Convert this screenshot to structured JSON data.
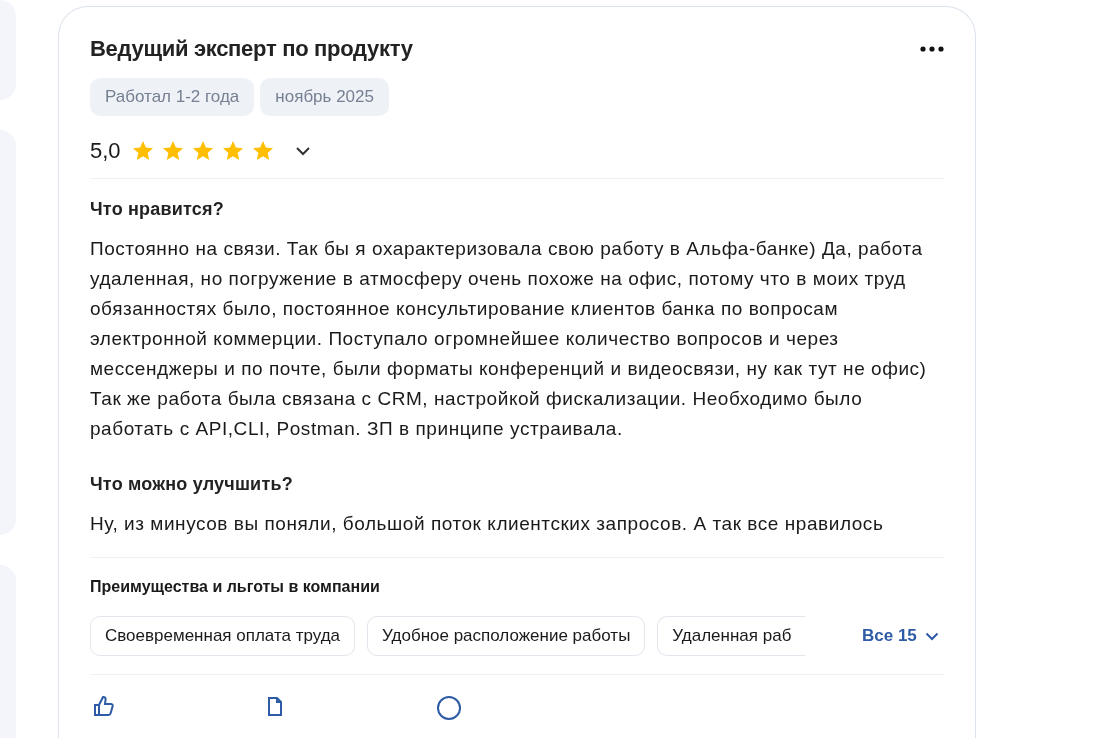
{
  "review": {
    "title": "Ведущий эксперт по продукту",
    "tags": [
      "Работал 1-2 года",
      "ноябрь 2025"
    ],
    "rating": {
      "score": "5,0",
      "stars": 5,
      "expanded": false
    },
    "sections": [
      {
        "heading": "Что нравится?",
        "text": "Постоянно на связи. Так бы я охарактеризовала свою работу в Альфа-банке) Да, работа удаленная, но погружение в атмосферу очень похоже на офис, потому что в моих труд обязанностях было, постоянное консультирование клиентов банка по вопросам электронной коммерции. Поступало огромнейшее количество вопросов и через мессенджеры и по почте, были форматы конференций и видеосвязи, ну как тут не офис) Так же работа была связана с CRM, настройкой фискализации. Необходимо было работать с API,CLI, Postman. ЗП в принципе устраивала."
      },
      {
        "heading": "Что можно улучшить?",
        "text": "Ну, из минусов вы поняли, большой поток клиентских запросов. А так все нравилось"
      }
    ],
    "benefits": {
      "heading": "Преимущества и льготы в компании",
      "items": [
        "Своевременная оплата труда",
        "Удобное расположение работы",
        "Удаленная раб"
      ],
      "more": "Все 15"
    }
  }
}
